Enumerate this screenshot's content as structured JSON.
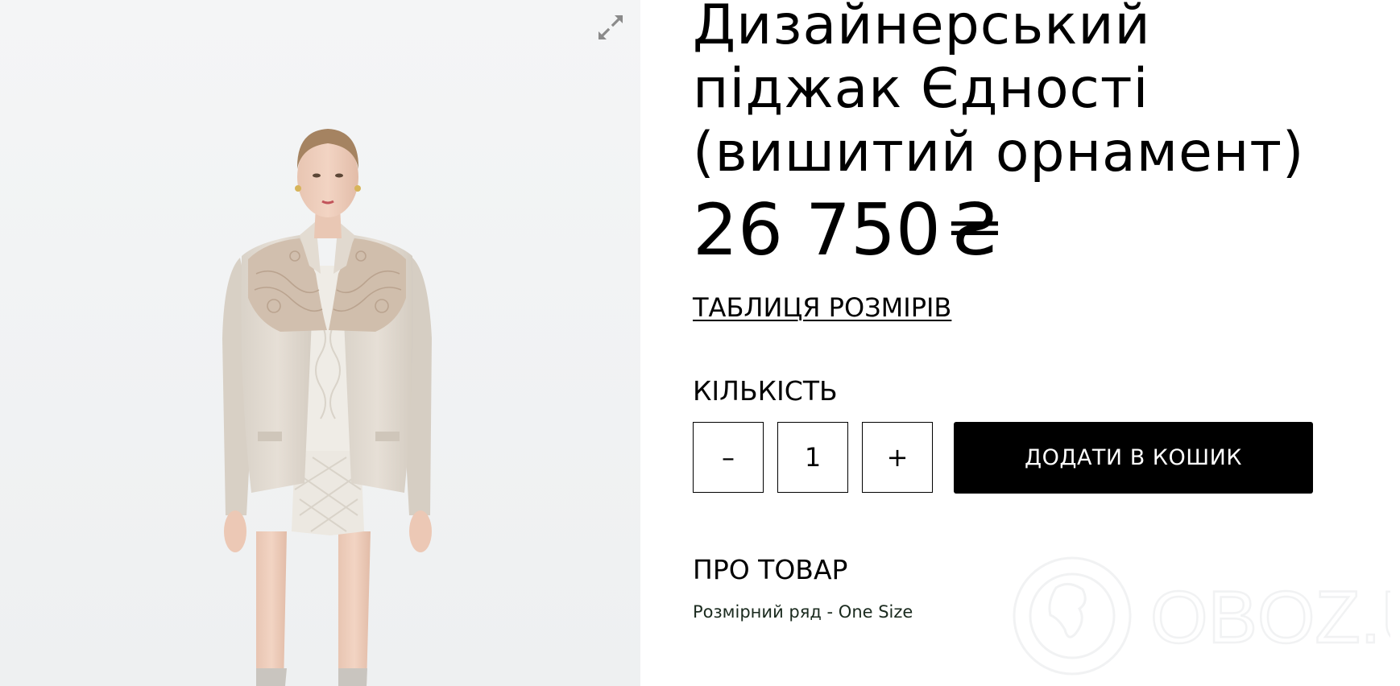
{
  "product": {
    "title_line1": "Дизайнерський",
    "title_line2": "піджак Єдності",
    "title_line3": "(вишитий орнамент)",
    "price_amount": "26 750",
    "price_currency": "₴",
    "size_table_link": "ТАБЛИЦЯ РОЗМІРІВ",
    "quantity_label": "КІЛЬКІСТЬ",
    "quantity_decrement": "–",
    "quantity_value": "1",
    "quantity_increment": "+",
    "add_to_cart_label": "ДОДАТИ В КОШИК",
    "about_label": "ПРО ТОВАР",
    "size_range_text": "Розмірний ряд - One Size"
  },
  "gallery": {
    "expand_icon": "expand-arrows-icon",
    "background_color": "#f3f4f5"
  },
  "watermark": {
    "text": "OBOZ.UA",
    "icon": "globe-icon"
  },
  "colors": {
    "text": "#000000",
    "button_bg": "#000000",
    "button_text": "#ffffff",
    "size_range_text": "#1a2a1e"
  }
}
